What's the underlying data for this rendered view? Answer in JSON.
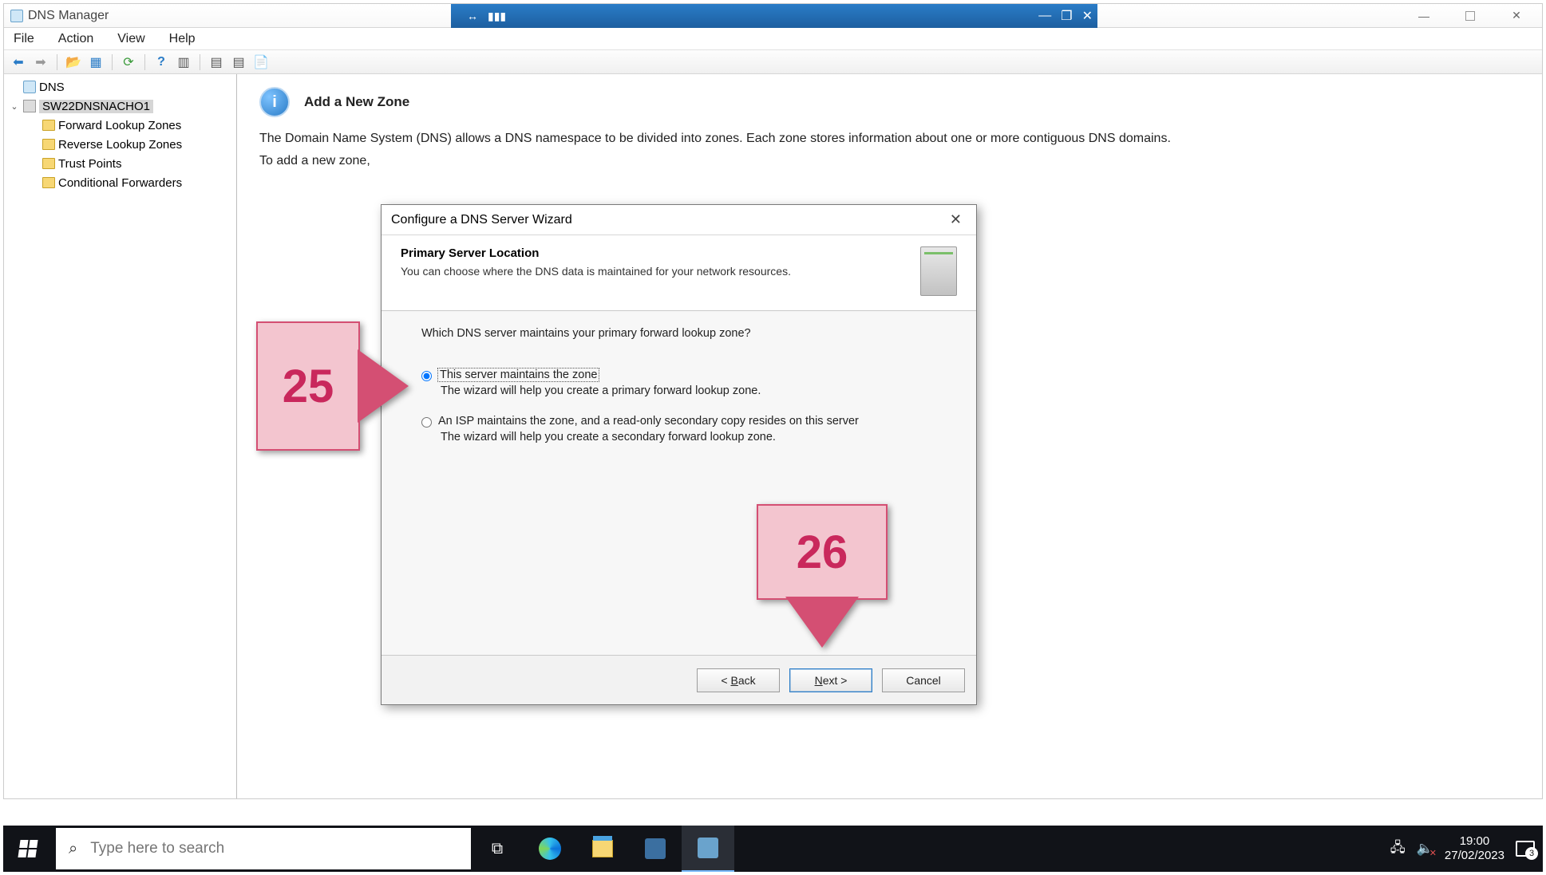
{
  "window": {
    "title": "DNS Manager",
    "vm_band": {
      "pin_glyph": "↔",
      "signal_glyph": "▮▮▮",
      "minimize": "—",
      "restore": "❐",
      "close": "✕"
    },
    "host_controls": {
      "minimize": "—",
      "maximize": "☐",
      "close": "✕"
    }
  },
  "menubar": [
    "File",
    "Action",
    "View",
    "Help"
  ],
  "toolbar": {
    "back": "⬅",
    "forward": "➡",
    "up": "📂",
    "props": "▦",
    "refresh": "⟳",
    "help": "?",
    "grid": "▥",
    "list1": "▤",
    "list2": "▤",
    "newzone": "📄"
  },
  "tree": {
    "root": "DNS",
    "server": "SW22DNSNACHO1",
    "items": [
      "Forward Lookup Zones",
      "Reverse Lookup Zones",
      "Trust Points",
      "Conditional Forwarders"
    ]
  },
  "main": {
    "heading": "Add a New Zone",
    "intro": "The Domain Name System (DNS) allows a DNS namespace to be divided into zones. Each zone stores information about one or more contiguous DNS domains.",
    "intro2": "To add a new zone,"
  },
  "wizard": {
    "title": "Configure a DNS Server Wizard",
    "close_glyph": "✕",
    "head_title": "Primary Server Location",
    "head_sub": "You can choose where the DNS data is maintained for your network resources.",
    "question": "Which DNS server maintains your primary forward lookup zone?",
    "option1_label": "This server maintains the zone",
    "option1_desc": "The wizard will help you create a primary forward lookup zone.",
    "option2_label_a": "An ISP maintains the zone, and a read-only secondary copy resides on this server",
    "option2_desc": "The wizard will help you create a secondary forward lookup zone.",
    "back_prefix": "< ",
    "back_u": "B",
    "back_rest": "ack",
    "next_u": "N",
    "next_rest": "ext >",
    "cancel": "Cancel"
  },
  "callouts": {
    "c25": "25",
    "c26": "26"
  },
  "taskbar": {
    "search_placeholder": "Type here to search",
    "time": "19:00",
    "date": "27/02/2023",
    "notif_count": "3"
  }
}
